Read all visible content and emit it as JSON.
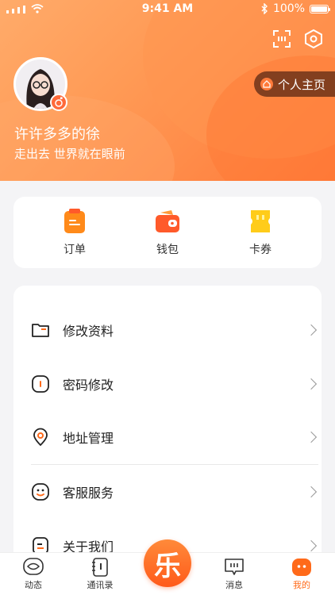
{
  "status_bar": {
    "time": "9:41 AM",
    "battery": "100%"
  },
  "header": {
    "profile_button_label": "个人主页",
    "username": "许许多多的徐",
    "motto": "走出去 世界就在眼前"
  },
  "quick_actions": [
    {
      "label": "订单",
      "icon": "order-icon"
    },
    {
      "label": "钱包",
      "icon": "wallet-icon"
    },
    {
      "label": "卡券",
      "icon": "coupon-icon"
    }
  ],
  "menu": [
    {
      "label": "修改资料",
      "icon": "folder-icon"
    },
    {
      "label": "密码修改",
      "icon": "lock-icon"
    },
    {
      "label": "地址管理",
      "icon": "location-icon"
    },
    {
      "label": "客服服务",
      "icon": "service-icon"
    },
    {
      "label": "关于我们",
      "icon": "about-icon"
    }
  ],
  "tabbar": {
    "items": [
      {
        "label": "动态",
        "icon": "feed-icon"
      },
      {
        "label": "通讯录",
        "icon": "contacts-icon"
      },
      {
        "label": "消息",
        "icon": "message-icon"
      },
      {
        "label": "我的",
        "icon": "me-icon"
      }
    ],
    "center_glyph": "乐",
    "active": "我的"
  },
  "colors": {
    "accent": "#ff6a1a",
    "hero_start": "#ffab6a",
    "hero_end": "#ff7a3a"
  }
}
